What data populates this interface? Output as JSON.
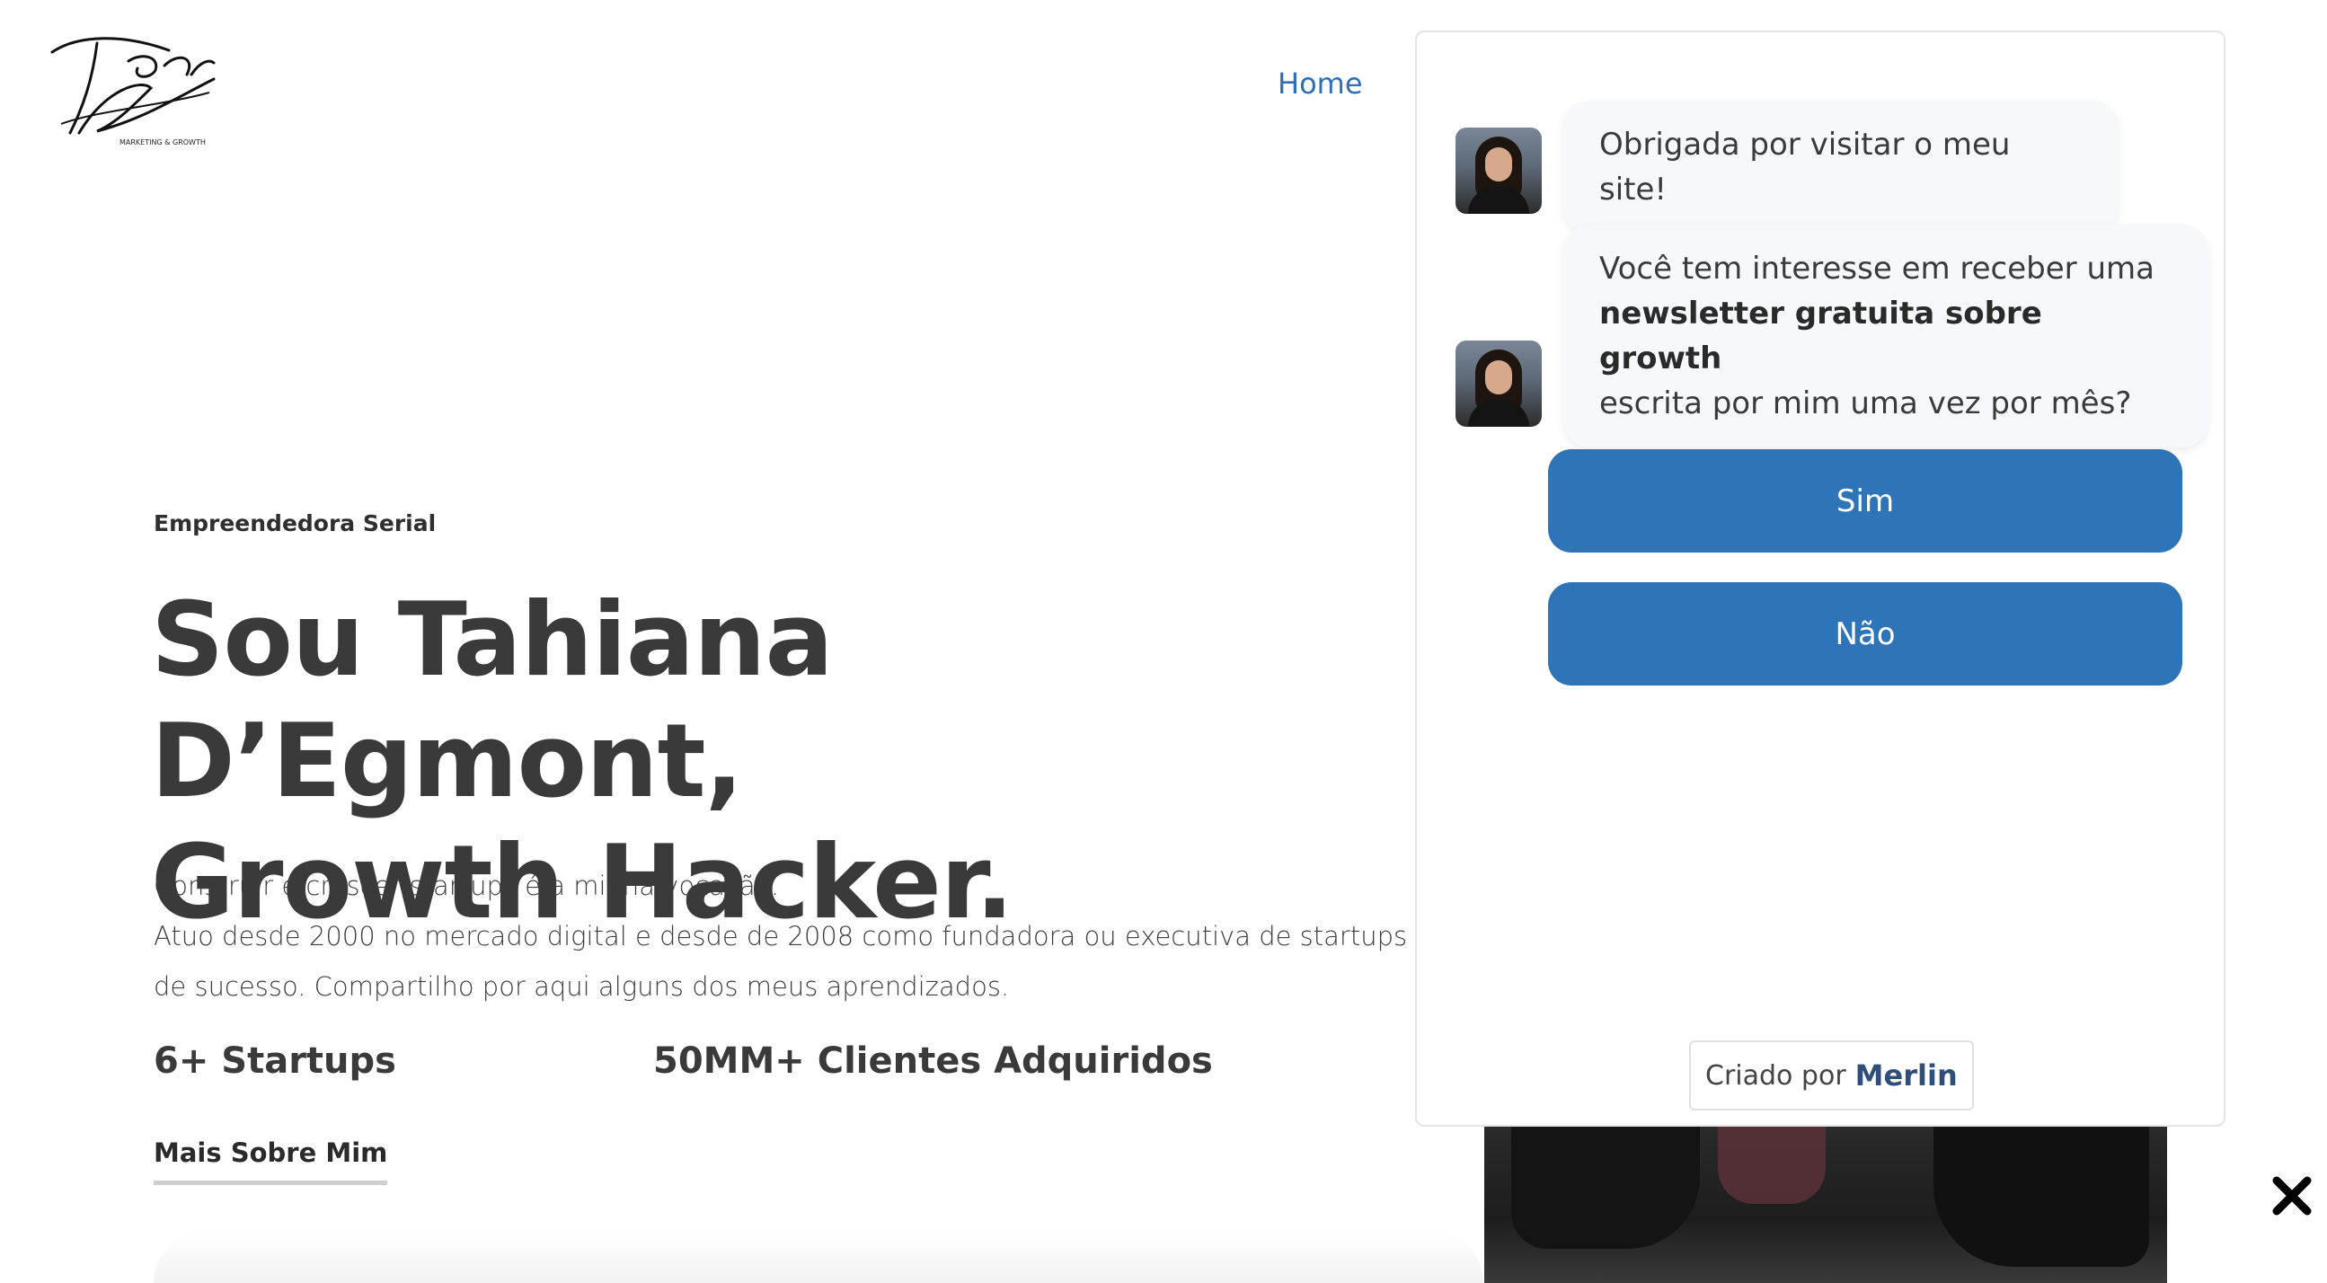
{
  "logo": {
    "alt": "Tahiana D'Egmont",
    "tagline": "MARKETING & GROWTH"
  },
  "nav": {
    "home": "Home"
  },
  "hero": {
    "eyebrow": "Empreendedora Serial",
    "title_line1": "Sou Tahiana D’Egmont,",
    "title_line2": "Growth Hacker.",
    "desc_line1": "Construir e crescer startups é a minha vocação.",
    "desc_line2": "Atuo desde 2000 no mercado digital e desde de 2008 como fundadora ou executiva de startups",
    "desc_line3": "de sucesso. Compartilho por aqui alguns dos meus aprendizados.",
    "stat1": "6+ Startups",
    "stat2": "50MM+ Clientes Adquiridos",
    "more_link": "Mais Sobre Mim"
  },
  "chat": {
    "message1": "Obrigada por visitar o meu site!",
    "message2_part1": "Você tem interesse em receber uma",
    "message2_bold": "newsletter gratuita sobre growth",
    "message2_part2": "escrita por mim uma vez por mês?",
    "option_yes": "Sim",
    "option_no": "Não",
    "powered_prefix": "Criado por",
    "powered_brand": "Merlin"
  },
  "colors": {
    "accent": "#2e74b9",
    "nav_link": "#2e6fb7",
    "heading": "#3a3a3a",
    "bubble_bg": "#f6f8fb"
  },
  "icons": {
    "close": "close-icon"
  }
}
